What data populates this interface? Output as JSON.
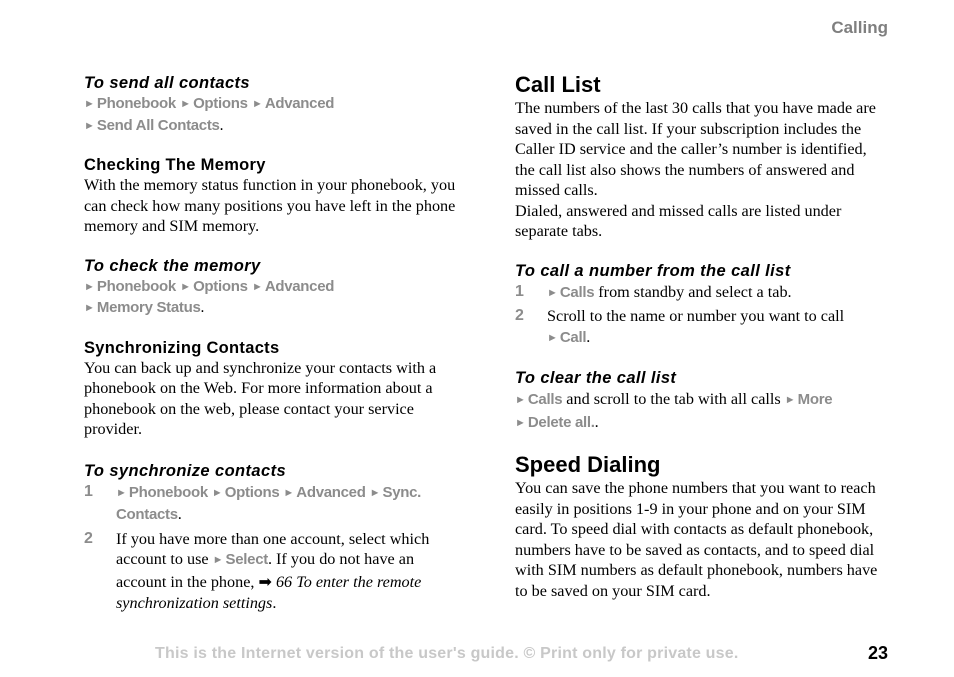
{
  "header": {
    "section": "Calling"
  },
  "left": {
    "send_all": {
      "title": "To send all contacts",
      "path_line1": [
        "Phonebook",
        "Options",
        "Advanced"
      ],
      "path_line2": [
        "Send All Contacts"
      ]
    },
    "checking": {
      "title": "Checking The Memory",
      "body": "With the memory status function in your phonebook, you can check how many positions you have left in the phone memory and SIM memory."
    },
    "check_memory": {
      "title": "To check the memory",
      "path_line1": [
        "Phonebook",
        "Options",
        "Advanced"
      ],
      "path_line2": [
        "Memory Status"
      ]
    },
    "sync": {
      "title": "Synchronizing Contacts",
      "body": "You can back up and synchronize your contacts with a phonebook on the Web. For more information about a phonebook on the web, please contact your service provider."
    },
    "to_sync": {
      "title": "To synchronize contacts",
      "steps": [
        {
          "num": "1",
          "path": [
            "Phonebook",
            "Options",
            "Advanced",
            "Sync."
          ],
          "path_cont": "Contacts"
        },
        {
          "num": "2",
          "text_a": "If you have more than one account, select which account to use",
          "menu": "Select",
          "text_b": ". If you do not have an account in the phone,",
          "ref_page": "66",
          "ref_title": "To enter the remote synchronization settings"
        }
      ]
    }
  },
  "right": {
    "call_list": {
      "title": "Call List",
      "body1": "The numbers of the last 30 calls that you have made are saved in the call list. If your subscription includes the Caller ID service and the caller’s number is identified, the call list also shows the numbers of answered and missed calls.",
      "body2": "Dialed, answered and missed calls are listed under separate tabs."
    },
    "call_number": {
      "title": "To call a number from the call list",
      "steps": [
        {
          "num": "1",
          "menu": "Calls",
          "text": " from standby and select a tab."
        },
        {
          "num": "2",
          "text": "Scroll to the name or number you want to call",
          "menu": "Call"
        }
      ]
    },
    "clear_list": {
      "title": "To clear the call list",
      "menu1": "Calls",
      "text": " and scroll to the tab with all calls ",
      "menu2": "More",
      "menu3": "Delete all."
    },
    "speed": {
      "title": "Speed Dialing",
      "body": "You can save the phone numbers that you want to reach easily in positions 1-9 in your phone and on your SIM card. To speed dial with contacts as default phonebook, numbers have to be saved as contacts, and to speed dial with SIM numbers as default phonebook, numbers have to be saved on your SIM card."
    }
  },
  "footer": {
    "notice": "This is the Internet version of the user's guide. © Print only for private use.",
    "page_number": "23"
  },
  "glyphs": {
    "menu_arrow": "►",
    "ref_arrow": "➡",
    "period": "."
  }
}
